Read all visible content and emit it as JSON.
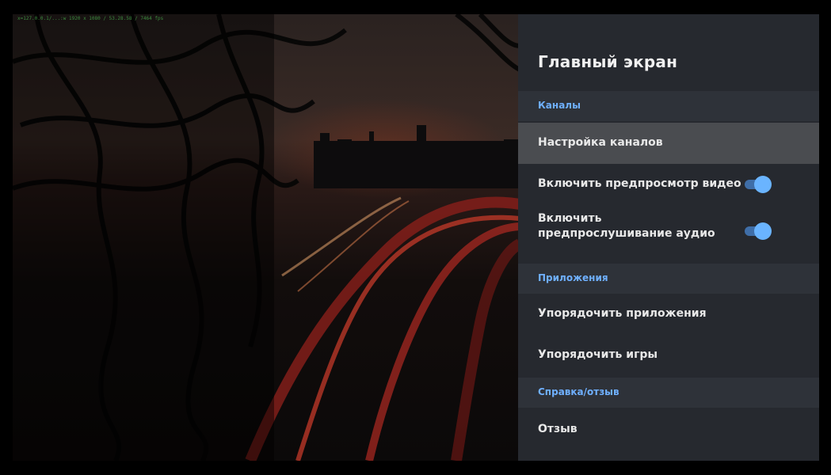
{
  "debug_text": "x=127.0.0.1/...:w 1920 x 1080 / 53.28.58 / 7464 fps",
  "panel": {
    "title": "Главный экран",
    "sections": [
      {
        "header": "Каналы",
        "items": [
          {
            "label": "Настройка каналов",
            "focused": true
          },
          {
            "label": "Включить предпросмотр видео",
            "toggle": true
          },
          {
            "label": "Включить предпрослушивание аудио",
            "toggle": true
          }
        ]
      },
      {
        "header": "Приложения",
        "items": [
          {
            "label": "Упорядочить приложения"
          },
          {
            "label": "Упорядочить игры"
          }
        ]
      },
      {
        "header": "Справка/отзыв",
        "items": [
          {
            "label": "Отзыв"
          }
        ]
      }
    ]
  },
  "colors": {
    "accent": "#6fb0ff",
    "toggle_on": "#6ab4ff",
    "panel_bg": "#26292f",
    "focus_bg": "#4a4c50"
  }
}
